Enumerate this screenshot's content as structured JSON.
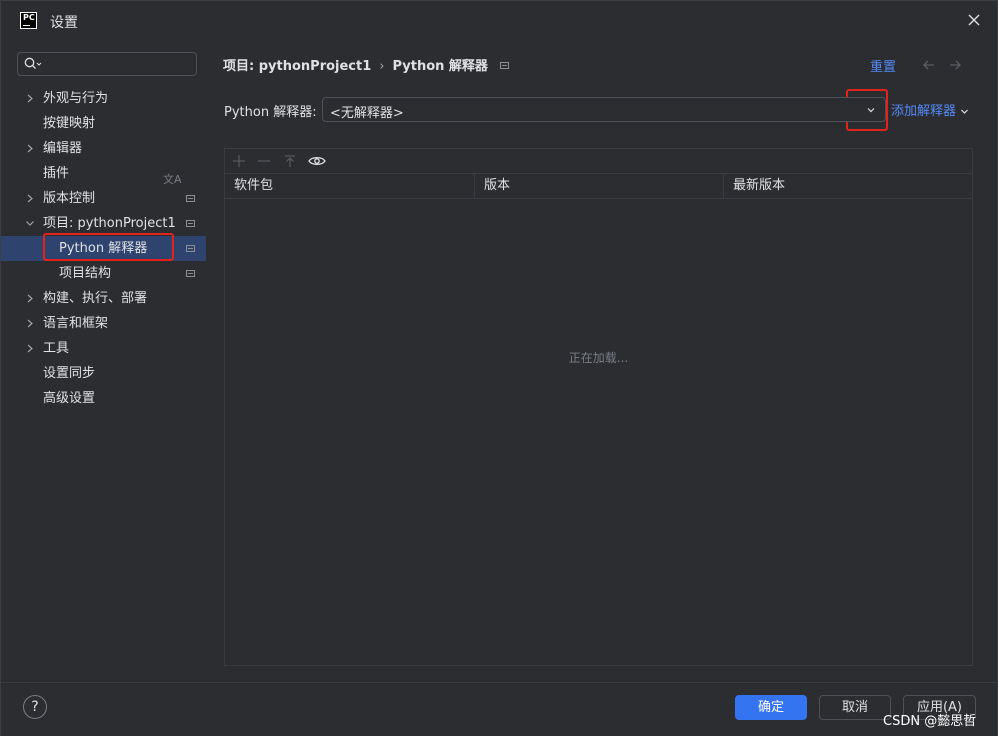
{
  "window": {
    "app_logo": "PC",
    "title": "设置",
    "close_icon": "close-icon"
  },
  "sidebar": {
    "search_placeholder": "",
    "items": [
      {
        "label": "外观与行为",
        "expandable": true
      },
      {
        "label": "按键映射",
        "expandable": false
      },
      {
        "label": "编辑器",
        "expandable": true
      },
      {
        "label": "插件",
        "expandable": false
      },
      {
        "label": "版本控制",
        "expandable": true
      },
      {
        "label": "项目: pythonProject1",
        "expandable": true,
        "expanded": true
      },
      {
        "label": "Python 解释器",
        "selected": true
      },
      {
        "label": "项目结构"
      },
      {
        "label": "构建、执行、部署",
        "expandable": true
      },
      {
        "label": "语言和框架",
        "expandable": true
      },
      {
        "label": "工具",
        "expandable": true
      },
      {
        "label": "设置同步",
        "expandable": false
      },
      {
        "label": "高级设置",
        "expandable": false
      }
    ]
  },
  "main": {
    "breadcrumb": {
      "parent": "项目: pythonProject1",
      "current": "Python 解释器"
    },
    "reset_label": "重置",
    "interpreter_label": "Python 解释器:",
    "interpreter_value": "<无解释器>",
    "add_interpreter_label": "添加解释器",
    "table": {
      "columns": [
        "软件包",
        "版本",
        "最新版本"
      ],
      "loading_text": "正在加载..."
    }
  },
  "footer": {
    "help_label": "?",
    "ok_label": "确定",
    "cancel_label": "取消",
    "apply_label": "应用(A)"
  },
  "watermark": "CSDN @懿思哲",
  "colors": {
    "accent": "#3574f0",
    "link": "#548af7",
    "selection": "#2e436e",
    "highlight_box": "#e0241b"
  }
}
